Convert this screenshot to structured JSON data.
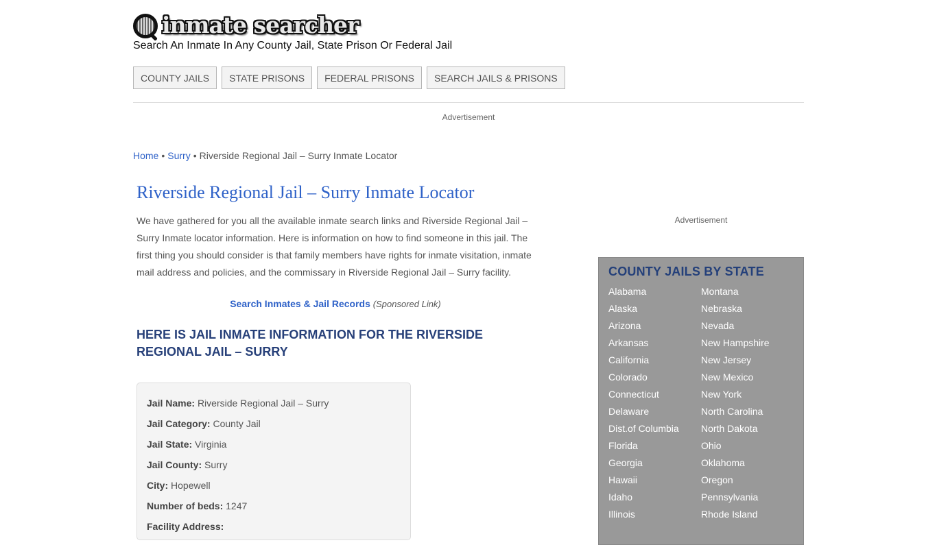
{
  "site": {
    "logo_text": "inmate searcher",
    "tagline": "Search An Inmate In Any County Jail, State Prison Or Federal Jail"
  },
  "nav": {
    "items": [
      {
        "label": "COUNTY JAILS"
      },
      {
        "label": "STATE PRISONS"
      },
      {
        "label": "FEDERAL PRISONS"
      },
      {
        "label": "SEARCH JAILS & PRISONS"
      }
    ]
  },
  "ads": {
    "top_label": "Advertisement",
    "side_label": "Advertisement"
  },
  "breadcrumb": {
    "items": [
      {
        "label": "Home",
        "link": true
      },
      {
        "label": "Surry",
        "link": true
      },
      {
        "label": "Riverside Regional Jail – Surry Inmate Locator",
        "link": false
      }
    ],
    "separator": "•"
  },
  "main": {
    "title": "Riverside Regional Jail – Surry Inmate Locator",
    "intro": "We have gathered for you all the available inmate search links and Riverside Regional Jail – Surry Inmate locator information. Here is information on how to find someone in this jail. The first thing you should consider is that family members have rights for inmate visitation, inmate mail address and policies, and the commissary in Riverside Regional Jail – Surry facility.",
    "sponsored_link": "Search Inmates & Jail Records",
    "sponsored_note": "(Sponsored Link)",
    "info_heading": "HERE IS JAIL INMATE INFORMATION FOR THE RIVERSIDE REGIONAL JAIL – SURRY",
    "info": [
      {
        "label": "Jail Name:",
        "value": "Riverside Regional Jail – Surry"
      },
      {
        "label": "Jail Category:",
        "value": "County Jail"
      },
      {
        "label": "Jail State:",
        "value": "Virginia"
      },
      {
        "label": "Jail County:",
        "value": "Surry"
      },
      {
        "label": "City:",
        "value": "Hopewell"
      },
      {
        "label": "Number of beds:",
        "value": "1247"
      },
      {
        "label": "Facility Address:",
        "value": ""
      }
    ]
  },
  "sidebar": {
    "title": "COUNTY JAILS BY STATE",
    "states": [
      "Alabama",
      "Alaska",
      "Arizona",
      "Arkansas",
      "California",
      "Colorado",
      "Connecticut",
      "Delaware",
      "Dist.of Columbia",
      "Florida",
      "Georgia",
      "Hawaii",
      "Idaho",
      "Illinois",
      "Montana",
      "Nebraska",
      "Nevada",
      "New Hampshire",
      "New Jersey",
      "New Mexico",
      "New York",
      "North Carolina",
      "North Dakota",
      "Ohio",
      "Oklahoma",
      "Oregon",
      "Pennsylvania",
      "Rhode Island"
    ]
  },
  "colors": {
    "link_blue": "#2f62c8",
    "heading_navy": "#274079",
    "sidebar_bg": "#999999"
  }
}
